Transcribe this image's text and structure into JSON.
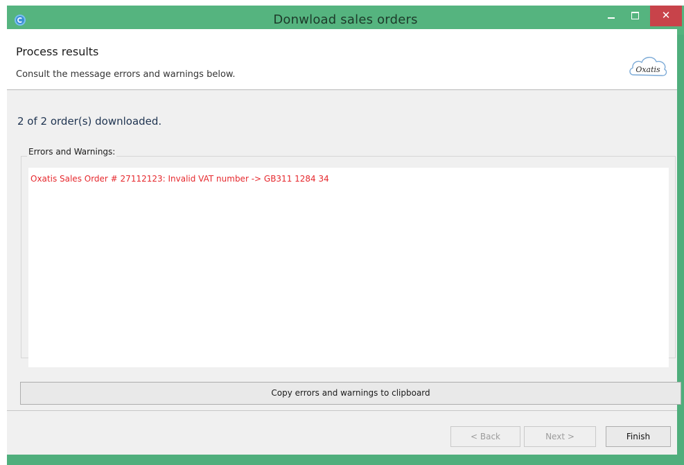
{
  "window": {
    "title": "Donwload sales orders",
    "controls": {
      "minimize_icon": "minimize-icon",
      "maximize_icon": "maximize-icon",
      "close_glyph": "✕"
    }
  },
  "header": {
    "title": "Process results",
    "subtitle": "Consult the message errors and warnings below.",
    "logo_text": "Oxatis"
  },
  "main": {
    "summary": "2 of 2  order(s) downloaded.",
    "group_label": "Errors and Warnings:",
    "messages": [
      "Oxatis Sales Order # 27112123: Invalid VAT number -> GB311 1284 34"
    ],
    "copy_button": "Copy errors and warnings to clipboard"
  },
  "footer": {
    "back_label": "< Back",
    "next_label": "Next >",
    "finish_label": "Finish"
  },
  "colors": {
    "titlebar": "#55b47f",
    "close_button": "#c8434a",
    "error_text": "#e6282d"
  }
}
